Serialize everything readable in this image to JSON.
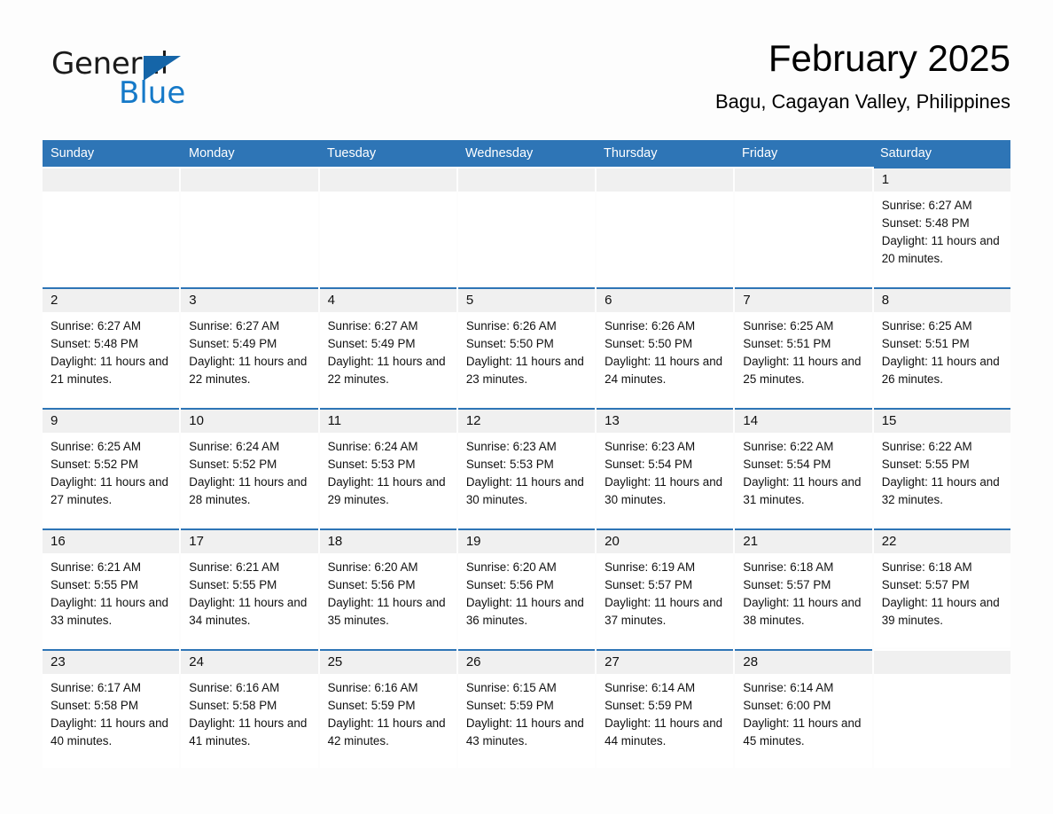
{
  "brand": {
    "word_general": "General",
    "word_blue": "Blue",
    "logo_icon": "triangle-logo-icon",
    "accent_color": "#1579c8"
  },
  "header": {
    "month_title": "February 2025",
    "location": "Bagu, Cagayan Valley, Philippines"
  },
  "calendar": {
    "header_color": "#2e75b6",
    "weekdays": [
      "Sunday",
      "Monday",
      "Tuesday",
      "Wednesday",
      "Thursday",
      "Friday",
      "Saturday"
    ],
    "weeks": [
      [
        {
          "day": "",
          "empty": true
        },
        {
          "day": "",
          "empty": true
        },
        {
          "day": "",
          "empty": true
        },
        {
          "day": "",
          "empty": true
        },
        {
          "day": "",
          "empty": true
        },
        {
          "day": "",
          "empty": true
        },
        {
          "day": "1",
          "sunrise": "Sunrise: 6:27 AM",
          "sunset": "Sunset: 5:48 PM",
          "daylight": "Daylight: 11 hours and 20 minutes."
        }
      ],
      [
        {
          "day": "2",
          "sunrise": "Sunrise: 6:27 AM",
          "sunset": "Sunset: 5:48 PM",
          "daylight": "Daylight: 11 hours and 21 minutes."
        },
        {
          "day": "3",
          "sunrise": "Sunrise: 6:27 AM",
          "sunset": "Sunset: 5:49 PM",
          "daylight": "Daylight: 11 hours and 22 minutes."
        },
        {
          "day": "4",
          "sunrise": "Sunrise: 6:27 AM",
          "sunset": "Sunset: 5:49 PM",
          "daylight": "Daylight: 11 hours and 22 minutes."
        },
        {
          "day": "5",
          "sunrise": "Sunrise: 6:26 AM",
          "sunset": "Sunset: 5:50 PM",
          "daylight": "Daylight: 11 hours and 23 minutes."
        },
        {
          "day": "6",
          "sunrise": "Sunrise: 6:26 AM",
          "sunset": "Sunset: 5:50 PM",
          "daylight": "Daylight: 11 hours and 24 minutes."
        },
        {
          "day": "7",
          "sunrise": "Sunrise: 6:25 AM",
          "sunset": "Sunset: 5:51 PM",
          "daylight": "Daylight: 11 hours and 25 minutes."
        },
        {
          "day": "8",
          "sunrise": "Sunrise: 6:25 AM",
          "sunset": "Sunset: 5:51 PM",
          "daylight": "Daylight: 11 hours and 26 minutes."
        }
      ],
      [
        {
          "day": "9",
          "sunrise": "Sunrise: 6:25 AM",
          "sunset": "Sunset: 5:52 PM",
          "daylight": "Daylight: 11 hours and 27 minutes."
        },
        {
          "day": "10",
          "sunrise": "Sunrise: 6:24 AM",
          "sunset": "Sunset: 5:52 PM",
          "daylight": "Daylight: 11 hours and 28 minutes."
        },
        {
          "day": "11",
          "sunrise": "Sunrise: 6:24 AM",
          "sunset": "Sunset: 5:53 PM",
          "daylight": "Daylight: 11 hours and 29 minutes."
        },
        {
          "day": "12",
          "sunrise": "Sunrise: 6:23 AM",
          "sunset": "Sunset: 5:53 PM",
          "daylight": "Daylight: 11 hours and 30 minutes."
        },
        {
          "day": "13",
          "sunrise": "Sunrise: 6:23 AM",
          "sunset": "Sunset: 5:54 PM",
          "daylight": "Daylight: 11 hours and 30 minutes."
        },
        {
          "day": "14",
          "sunrise": "Sunrise: 6:22 AM",
          "sunset": "Sunset: 5:54 PM",
          "daylight": "Daylight: 11 hours and 31 minutes."
        },
        {
          "day": "15",
          "sunrise": "Sunrise: 6:22 AM",
          "sunset": "Sunset: 5:55 PM",
          "daylight": "Daylight: 11 hours and 32 minutes."
        }
      ],
      [
        {
          "day": "16",
          "sunrise": "Sunrise: 6:21 AM",
          "sunset": "Sunset: 5:55 PM",
          "daylight": "Daylight: 11 hours and 33 minutes."
        },
        {
          "day": "17",
          "sunrise": "Sunrise: 6:21 AM",
          "sunset": "Sunset: 5:55 PM",
          "daylight": "Daylight: 11 hours and 34 minutes."
        },
        {
          "day": "18",
          "sunrise": "Sunrise: 6:20 AM",
          "sunset": "Sunset: 5:56 PM",
          "daylight": "Daylight: 11 hours and 35 minutes."
        },
        {
          "day": "19",
          "sunrise": "Sunrise: 6:20 AM",
          "sunset": "Sunset: 5:56 PM",
          "daylight": "Daylight: 11 hours and 36 minutes."
        },
        {
          "day": "20",
          "sunrise": "Sunrise: 6:19 AM",
          "sunset": "Sunset: 5:57 PM",
          "daylight": "Daylight: 11 hours and 37 minutes."
        },
        {
          "day": "21",
          "sunrise": "Sunrise: 6:18 AM",
          "sunset": "Sunset: 5:57 PM",
          "daylight": "Daylight: 11 hours and 38 minutes."
        },
        {
          "day": "22",
          "sunrise": "Sunrise: 6:18 AM",
          "sunset": "Sunset: 5:57 PM",
          "daylight": "Daylight: 11 hours and 39 minutes."
        }
      ],
      [
        {
          "day": "23",
          "sunrise": "Sunrise: 6:17 AM",
          "sunset": "Sunset: 5:58 PM",
          "daylight": "Daylight: 11 hours and 40 minutes."
        },
        {
          "day": "24",
          "sunrise": "Sunrise: 6:16 AM",
          "sunset": "Sunset: 5:58 PM",
          "daylight": "Daylight: 11 hours and 41 minutes."
        },
        {
          "day": "25",
          "sunrise": "Sunrise: 6:16 AM",
          "sunset": "Sunset: 5:59 PM",
          "daylight": "Daylight: 11 hours and 42 minutes."
        },
        {
          "day": "26",
          "sunrise": "Sunrise: 6:15 AM",
          "sunset": "Sunset: 5:59 PM",
          "daylight": "Daylight: 11 hours and 43 minutes."
        },
        {
          "day": "27",
          "sunrise": "Sunrise: 6:14 AM",
          "sunset": "Sunset: 5:59 PM",
          "daylight": "Daylight: 11 hours and 44 minutes."
        },
        {
          "day": "28",
          "sunrise": "Sunrise: 6:14 AM",
          "sunset": "Sunset: 6:00 PM",
          "daylight": "Daylight: 11 hours and 45 minutes."
        },
        {
          "day": "",
          "empty": true
        }
      ]
    ]
  }
}
